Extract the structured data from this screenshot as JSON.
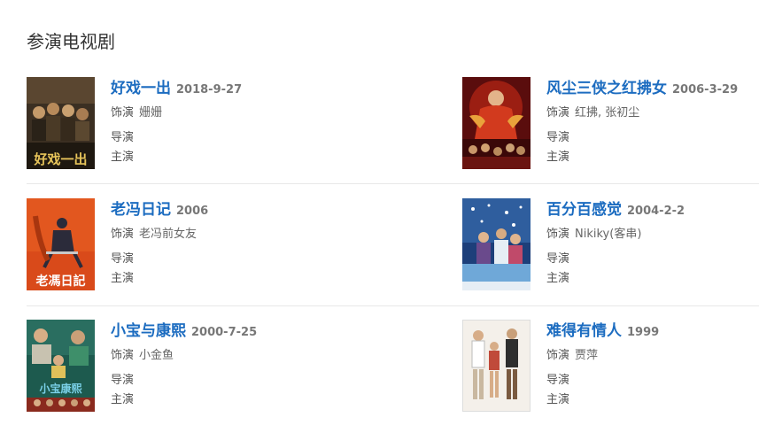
{
  "section": {
    "title": "参演电视剧"
  },
  "labels": {
    "role": "饰演",
    "director": "导演",
    "lead": "主演"
  },
  "items": [
    {
      "title": "好戏一出",
      "date": "2018-9-27",
      "role": "姗姗",
      "director": "",
      "lead": "",
      "poster_text": "好戏一出",
      "poster_colors": [
        "#3b2f22",
        "#8a6a3c",
        "#d9b55a"
      ]
    },
    {
      "title": "风尘三侠之红拂女",
      "date": "2006-3-29",
      "role": "红拂, 张初尘",
      "director": "",
      "lead": "",
      "poster_text": "",
      "poster_colors": [
        "#5a0d0d",
        "#c0301c",
        "#e9a23b"
      ]
    },
    {
      "title": "老冯日记",
      "date": "2006",
      "role": "老冯前女友",
      "director": "",
      "lead": "",
      "poster_text": "老馮日記",
      "poster_colors": [
        "#d94a1a",
        "#f07a2a",
        "#2b2b3a"
      ]
    },
    {
      "title": "百分百感觉",
      "date": "2004-2-2",
      "role": "Nikiky(客串)",
      "director": "",
      "lead": "",
      "poster_text": "",
      "poster_colors": [
        "#1d3f7a",
        "#6fa8d8",
        "#e6eef5"
      ]
    },
    {
      "title": "小宝与康熙",
      "date": "2000-7-25",
      "role": "小金鱼",
      "director": "",
      "lead": "",
      "poster_text": "小宝康熙",
      "poster_colors": [
        "#1d5a4e",
        "#3e8f6a",
        "#e0c15a"
      ]
    },
    {
      "title": "难得有情人",
      "date": "1999",
      "role": "贾萍",
      "director": "",
      "lead": "",
      "poster_text": "",
      "poster_colors": [
        "#f4f0ea",
        "#c9b8a0",
        "#7a5a40"
      ]
    }
  ]
}
